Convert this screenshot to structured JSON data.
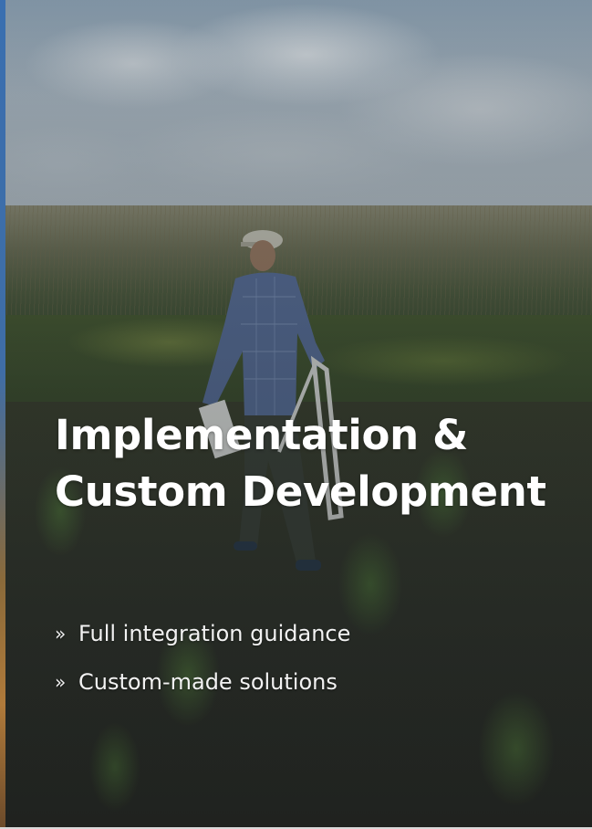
{
  "hero": {
    "title_line1": "Implementation &",
    "title_line2": "Custom Development",
    "features": [
      {
        "bullet": "»",
        "label": "Full integration guidance"
      },
      {
        "bullet": "»",
        "label": "Custom-made solutions"
      }
    ]
  },
  "colors": {
    "title_text": "#ffffff",
    "feature_text": "#f2f2f2",
    "left_accent": "#3a6fb0"
  }
}
